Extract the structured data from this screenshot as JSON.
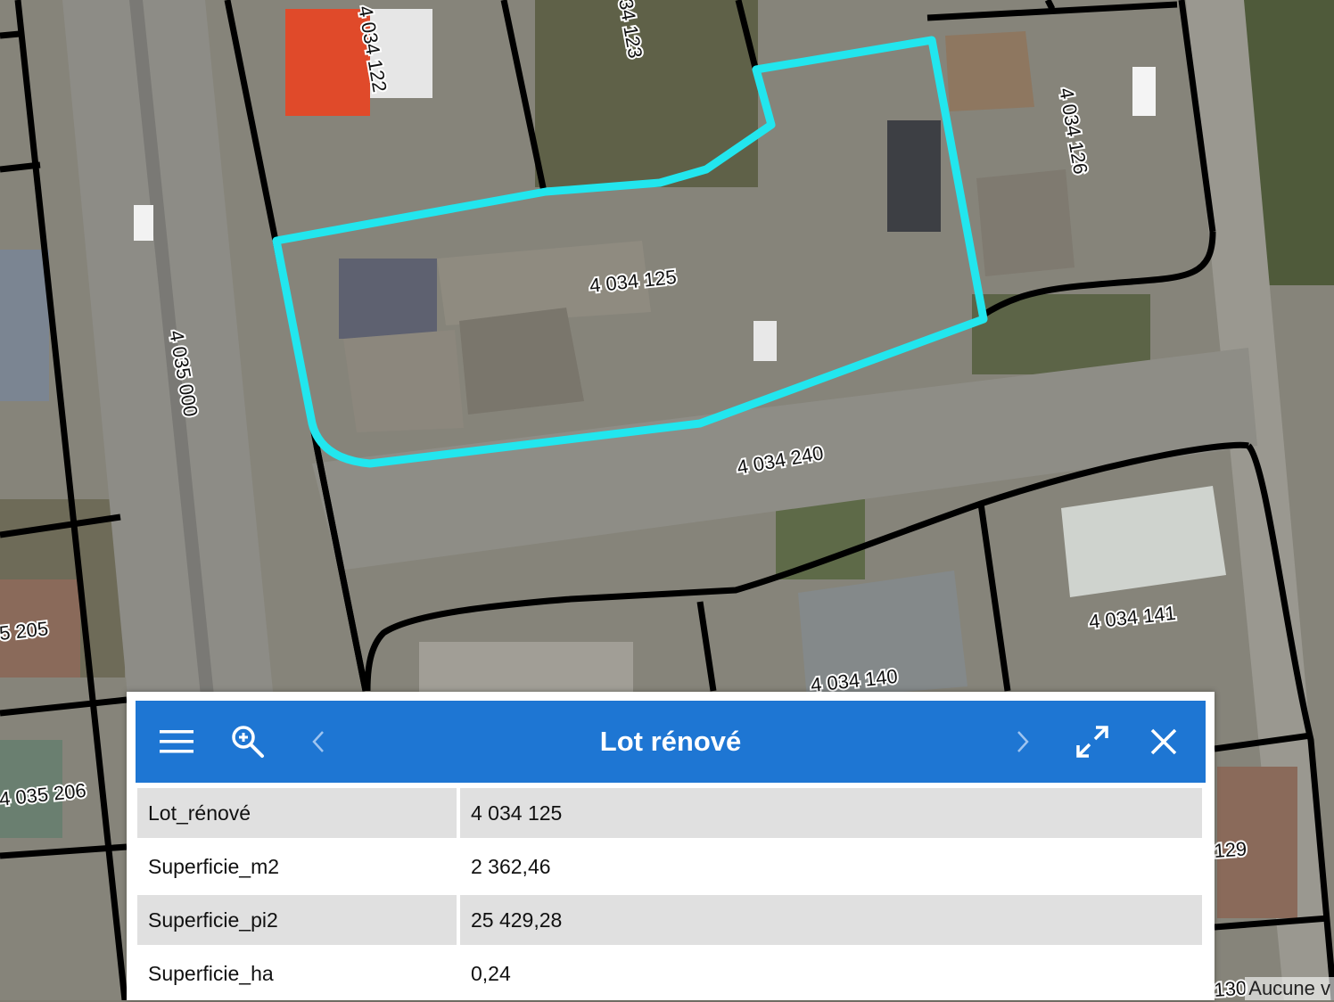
{
  "map": {
    "lot_labels": [
      {
        "id": "lot-4034122",
        "text": "4 034 122"
      },
      {
        "id": "lot-4034123",
        "text": "34 123"
      },
      {
        "id": "lot-4034126",
        "text": "4 034 126"
      },
      {
        "id": "lot-4034125",
        "text": "4 034 125"
      },
      {
        "id": "lot-4035000",
        "text": "4 035 000"
      },
      {
        "id": "lot-4034240",
        "text": "4 034 240"
      },
      {
        "id": "lot-4034141",
        "text": "4 034 141"
      },
      {
        "id": "lot-4034140",
        "text": "4 034 140"
      },
      {
        "id": "lot-5205",
        "text": "5 205"
      },
      {
        "id": "lot-4035206",
        "text": "4 035 206"
      },
      {
        "id": "lot-129",
        "text": "129"
      },
      {
        "id": "lot-130",
        "text": "130"
      }
    ],
    "selected_lot": "4 034 125",
    "highlight_color": "#22e6ee",
    "parcel_line_color": "#000000"
  },
  "popup": {
    "title": "Lot rénové",
    "menu_icon": "hamburger-menu-icon",
    "zoom_icon": "zoom-in-icon",
    "prev_icon": "chevron-left-icon",
    "next_icon": "chevron-right-icon",
    "maximize_icon": "expand-icon",
    "close_icon": "close-icon",
    "header_color": "#1e76d3",
    "rows": [
      {
        "key": "Lot_rénové",
        "value": "4 034 125"
      },
      {
        "key": "Superficie_m2",
        "value": "2 362,46"
      },
      {
        "key": "Superficie_pi2",
        "value": "25 429,28"
      },
      {
        "key": "Superficie_ha",
        "value": "0,24"
      }
    ]
  },
  "attribution": "Aucune v"
}
